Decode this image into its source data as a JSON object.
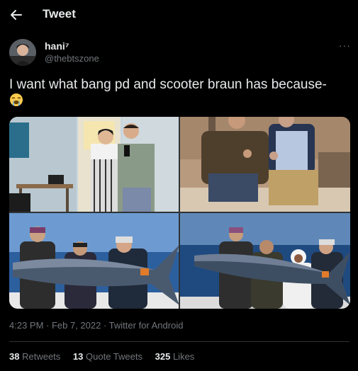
{
  "header": {
    "title": "Tweet",
    "back_icon": "arrow-left-icon"
  },
  "author": {
    "name": "hani⁷",
    "handle": "@thebtszone",
    "more_icon": "more-horizontal-icon"
  },
  "tweet": {
    "text": "I want what bang pd and scooter braun has because-",
    "emoji": "loudly-crying-face"
  },
  "meta": {
    "text": "4:23 PM · Feb 7, 2022 · Twitter for Android"
  },
  "stats": {
    "retweets_count": "38",
    "retweets_label": "Retweets",
    "quotes_count": "13",
    "quotes_label": "Quote Tweets",
    "likes_count": "325",
    "likes_label": "Likes"
  },
  "colors": {
    "background": "#000000",
    "text": "#e7e9ea",
    "secondary": "#71767b",
    "divider": "#2f3336"
  }
}
